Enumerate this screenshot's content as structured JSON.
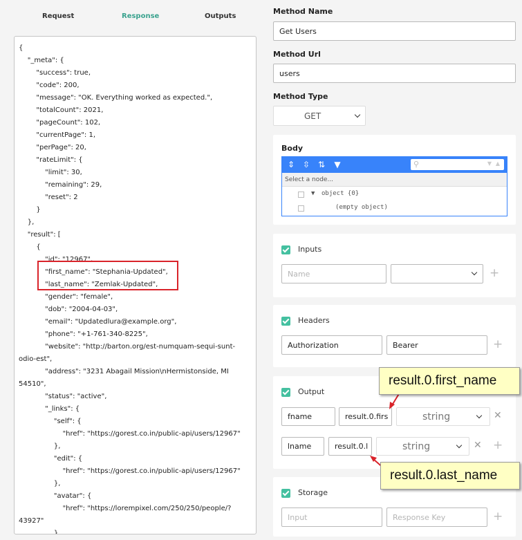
{
  "tabs": {
    "request": "Request",
    "response": "Response",
    "outputs": "Outputs"
  },
  "response_json_lines": [
    "{",
    "    \"_meta\": {",
    "        \"success\": true,",
    "        \"code\": 200,",
    "        \"message\": \"OK. Everything worked as expected.\",",
    "        \"totalCount\": 2021,",
    "        \"pageCount\": 102,",
    "        \"currentPage\": 1,",
    "        \"perPage\": 20,",
    "        \"rateLimit\": {",
    "            \"limit\": 30,",
    "            \"remaining\": 29,",
    "            \"reset\": 2",
    "        }",
    "    },",
    "    \"result\": [",
    "        {",
    "            \"id\": \"12967\",",
    "            \"first_name\": \"Stephania-Updated\",",
    "            \"last_name\": \"Zemlak-Updated\",",
    "            \"gender\": \"female\",",
    "            \"dob\": \"2004-04-03\",",
    "            \"email\": \"Updatedlura@example.org\",",
    "            \"phone\": \"+1-761-340-8225\",",
    "            \"website\": \"http://barton.org/est-numquam-sequi-sunt-",
    "odio-est\",",
    "            \"address\": \"3231 Abagail Mission\\nHermistonside, MI",
    "54510\",",
    "            \"status\": \"active\",",
    "            \"_links\": {",
    "                \"self\": {",
    "                    \"href\": \"https://gorest.co.in/public-api/users/12967\"",
    "                },",
    "                \"edit\": {",
    "                    \"href\": \"https://gorest.co.in/public-api/users/12967\"",
    "                },",
    "                \"avatar\": {",
    "                    \"href\": \"https://lorempixel.com/250/250/people/?",
    "43927\"",
    "                }"
  ],
  "method_name": {
    "label": "Method Name",
    "value": "Get Users"
  },
  "method_url": {
    "label": "Method Url",
    "value": "users"
  },
  "method_type": {
    "label": "Method Type",
    "value": "GET"
  },
  "body": {
    "label": "Body",
    "select_placeholder": "Select a node...",
    "tree_root": "object {0}",
    "tree_empty": "(empty object)"
  },
  "inputs": {
    "title": "Inputs",
    "name_placeholder": "Name"
  },
  "headers": {
    "title": "Headers",
    "key": "Authorization",
    "value": "Bearer"
  },
  "output": {
    "title": "Output",
    "row1": {
      "name": "fname",
      "path": "result.0.firs",
      "type": "string"
    },
    "row2": {
      "name": "lname",
      "path": "result.0.l",
      "type": "string"
    }
  },
  "storage": {
    "title": "Storage",
    "input_placeholder": "Input",
    "key_placeholder": "Response Key"
  },
  "callouts": {
    "first": "result.0.first_name",
    "last": "result.0.last_name"
  },
  "colors": {
    "accent": "#3aa28e",
    "checkbox": "#44c0a0",
    "highlight": "#d9232a",
    "editor_blue": "#3883fa",
    "callout_bg": "#ffffc4"
  }
}
